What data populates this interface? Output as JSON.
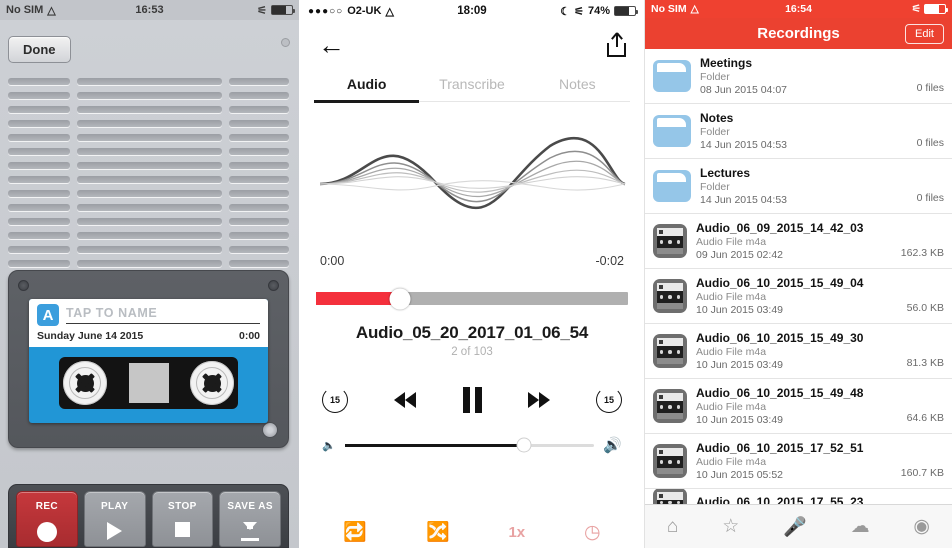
{
  "left_panel": {
    "status_bar": {
      "carrier": "No SIM",
      "wifi_icon": "wifi-icon",
      "time": "16:53",
      "bluetooth_icon": "bluetooth-icon",
      "battery_icon": "battery-icon"
    },
    "done_label": "Done",
    "cassette": {
      "badge": "A",
      "name_placeholder": "TAP TO NAME",
      "date": "Sunday June 14 2015",
      "duration": "0:00"
    },
    "transport": [
      {
        "label": "REC",
        "icon": "record-circle-icon"
      },
      {
        "label": "PLAY",
        "icon": "play-triangle-icon"
      },
      {
        "label": "STOP",
        "icon": "stop-square-icon"
      },
      {
        "label": "SAVE AS",
        "icon": "download-arrow-icon"
      }
    ]
  },
  "mid_panel": {
    "status_bar": {
      "signal_dots": "●●●○○",
      "carrier": "O2-UK",
      "wifi_icon": "wifi-icon",
      "time": "18:09",
      "moon_icon": "moon-icon",
      "bluetooth_icon": "bluetooth-icon",
      "battery_percent": "74%"
    },
    "nav": {
      "back_icon": "back-arrow-icon",
      "share_icon": "share-icon"
    },
    "tabs": [
      {
        "label": "Audio",
        "active": true
      },
      {
        "label": "Transcribe",
        "active": false
      },
      {
        "label": "Notes",
        "active": false
      }
    ],
    "waveform": {
      "start_time": "0:00",
      "remaining_time": "-0:02",
      "progress_percent": 27
    },
    "track": {
      "title": "Audio_05_20_2017_01_06_54",
      "position": "2 of 103"
    },
    "controls": {
      "skip_back_label": "15",
      "rewind_icon": "rewind-icon",
      "pause_icon": "pause-icon",
      "forward_icon": "fast-forward-icon",
      "skip_forward_label": "15"
    },
    "volume": {
      "low_icon": "speaker-low-icon",
      "high_icon": "speaker-high-icon",
      "level_percent": 72
    },
    "bottom_bar": {
      "repeat_icon": "repeat-icon",
      "shuffle_icon": "shuffle-icon",
      "speed_label": "1x",
      "timer_icon": "timer-clock-icon",
      "color": "#e8a2a2"
    }
  },
  "right_panel": {
    "status_bar": {
      "carrier": "No SIM",
      "wifi_icon": "wifi-icon",
      "time": "16:54",
      "bluetooth_icon": "bluetooth-icon",
      "battery_icon": "battery-icon"
    },
    "header": {
      "title": "Recordings",
      "edit_label": "Edit",
      "color": "#eb4130"
    },
    "rows": [
      {
        "icon": "folder-icon",
        "name": "Meetings",
        "type": "Folder",
        "date": "08 Jun 2015 04:07",
        "meta": "0 files"
      },
      {
        "icon": "folder-icon",
        "name": "Notes",
        "type": "Folder",
        "date": "14 Jun 2015 04:53",
        "meta": "0 files"
      },
      {
        "icon": "folder-icon",
        "name": "Lectures",
        "type": "Folder",
        "date": "14 Jun 2015 04:53",
        "meta": "0 files"
      },
      {
        "icon": "cassette-file-icon",
        "name": "Audio_06_09_2015_14_42_03",
        "type": "Audio File m4a",
        "date": "09 Jun 2015 02:42",
        "meta": "162.3 KB"
      },
      {
        "icon": "cassette-file-icon",
        "name": "Audio_06_10_2015_15_49_04",
        "type": "Audio File m4a",
        "date": "10 Jun 2015 03:49",
        "meta": "56.0 KB"
      },
      {
        "icon": "cassette-file-icon",
        "name": "Audio_06_10_2015_15_49_30",
        "type": "Audio File m4a",
        "date": "10 Jun 2015 03:49",
        "meta": "81.3 KB"
      },
      {
        "icon": "cassette-file-icon",
        "name": "Audio_06_10_2015_15_49_48",
        "type": "Audio File m4a",
        "date": "10 Jun 2015 03:49",
        "meta": "64.6 KB"
      },
      {
        "icon": "cassette-file-icon",
        "name": "Audio_06_10_2015_17_52_51",
        "type": "Audio File m4a",
        "date": "10 Jun 2015 05:52",
        "meta": "160.7 KB"
      }
    ],
    "partial_row": {
      "icon": "cassette-file-icon",
      "name": "Audio_06_10_2015_17_55_23"
    },
    "tab_bar": [
      {
        "icon": "home-icon",
        "glyph": "⌂",
        "active": false
      },
      {
        "icon": "star-icon",
        "glyph": "☆",
        "active": false
      },
      {
        "icon": "microphone-icon",
        "glyph": "•",
        "active": true
      },
      {
        "icon": "cloud-icon",
        "glyph": "☁",
        "active": false
      },
      {
        "icon": "settings-icon",
        "glyph": "⊙",
        "active": false
      }
    ]
  }
}
